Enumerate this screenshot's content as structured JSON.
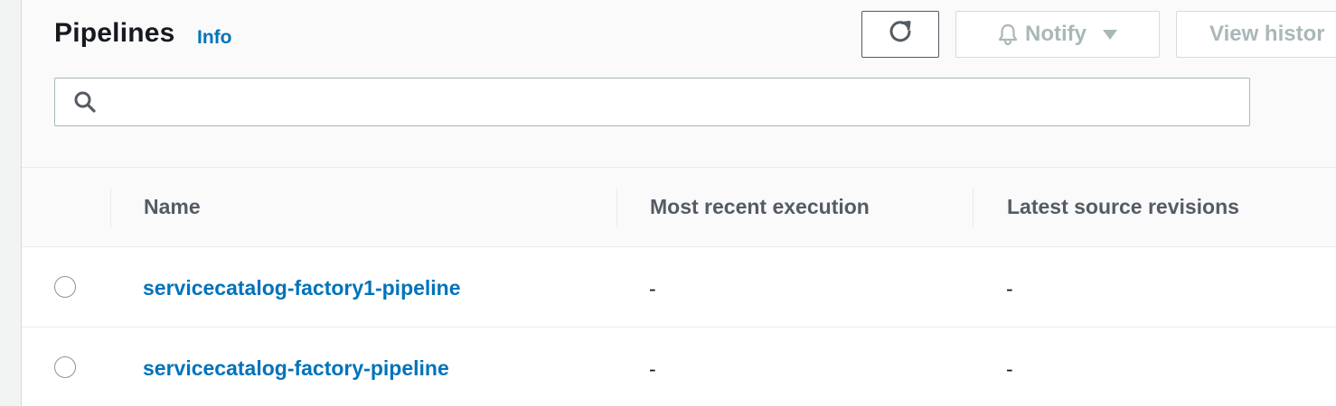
{
  "header": {
    "title": "Pipelines",
    "info_label": "Info"
  },
  "toolbar": {
    "refresh_icon": "refresh-icon",
    "notify_label": "Notify",
    "notify_icon": "bell-icon",
    "notify_caret": "caret-down-icon",
    "view_history_label": "View histor"
  },
  "search": {
    "value": "",
    "placeholder": "",
    "icon": "search-icon"
  },
  "table": {
    "columns": [
      "Name",
      "Most recent execution",
      "Latest source revisions"
    ],
    "rows": [
      {
        "name": "servicecatalog-factory1-pipeline",
        "most_recent_execution": "-",
        "latest_source_revisions": "-"
      },
      {
        "name": "servicecatalog-factory-pipeline",
        "most_recent_execution": "-",
        "latest_source_revisions": "-"
      }
    ]
  },
  "colors": {
    "link": "#0073bb",
    "heading": "#16191f",
    "column_header": "#545b64",
    "disabled": "#aab7b8"
  }
}
